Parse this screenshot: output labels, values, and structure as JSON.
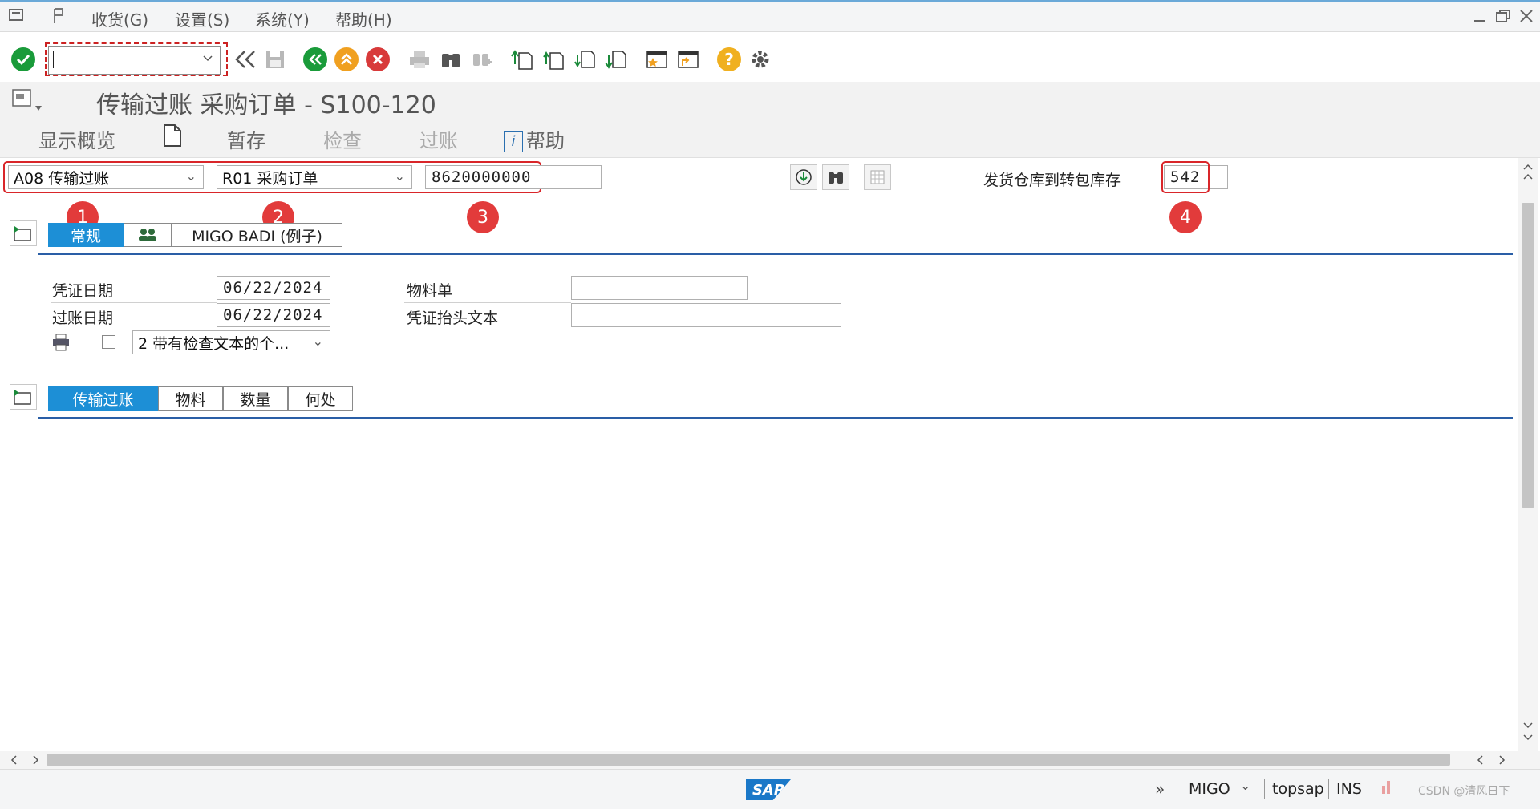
{
  "menu": {
    "items": [
      "收货(G)",
      "设置(S)",
      "系统(Y)",
      "帮助(H)"
    ]
  },
  "toolbar": {
    "command_value": "",
    "help_symbol": "?"
  },
  "title": "传输过账 采购订单 - S100-120",
  "appbar": {
    "show_overview": "显示概览",
    "hold": "暂存",
    "check": "检查",
    "post": "过账",
    "help": "帮助",
    "info_symbol": "i"
  },
  "selection": {
    "action": "A08 传输过账",
    "reference": "R01 采购订单",
    "po_number": "8620000000",
    "movement_desc": "发货仓库到转包库存",
    "movement_type": "542"
  },
  "markers": [
    "1",
    "2",
    "3",
    "4"
  ],
  "header_tabs": {
    "general": "常规",
    "badi": "MIGO BADI (例子)"
  },
  "header_fields": {
    "doc_date_label": "凭证日期",
    "doc_date": "06/22/2024",
    "post_date_label": "过账日期",
    "post_date": "06/22/2024",
    "print_option": "2 带有检查文本的个...",
    "material_slip_label": "物料单",
    "material_slip": "",
    "header_text_label": "凭证抬头文本",
    "header_text": ""
  },
  "item_tabs": [
    "传输过账",
    "物料",
    "数量",
    "何处"
  ],
  "status": {
    "logo": "SAP",
    "transaction": "MIGO",
    "system": "topsap",
    "mode": "INS",
    "watermark": "CSDN @清风日下"
  },
  "colors": {
    "accent": "#1d8fd6",
    "highlight_red": "#d9262a",
    "ok_green": "#1a9b3a",
    "exit_orange": "#f0a020",
    "cancel_red": "#d83a3a"
  }
}
